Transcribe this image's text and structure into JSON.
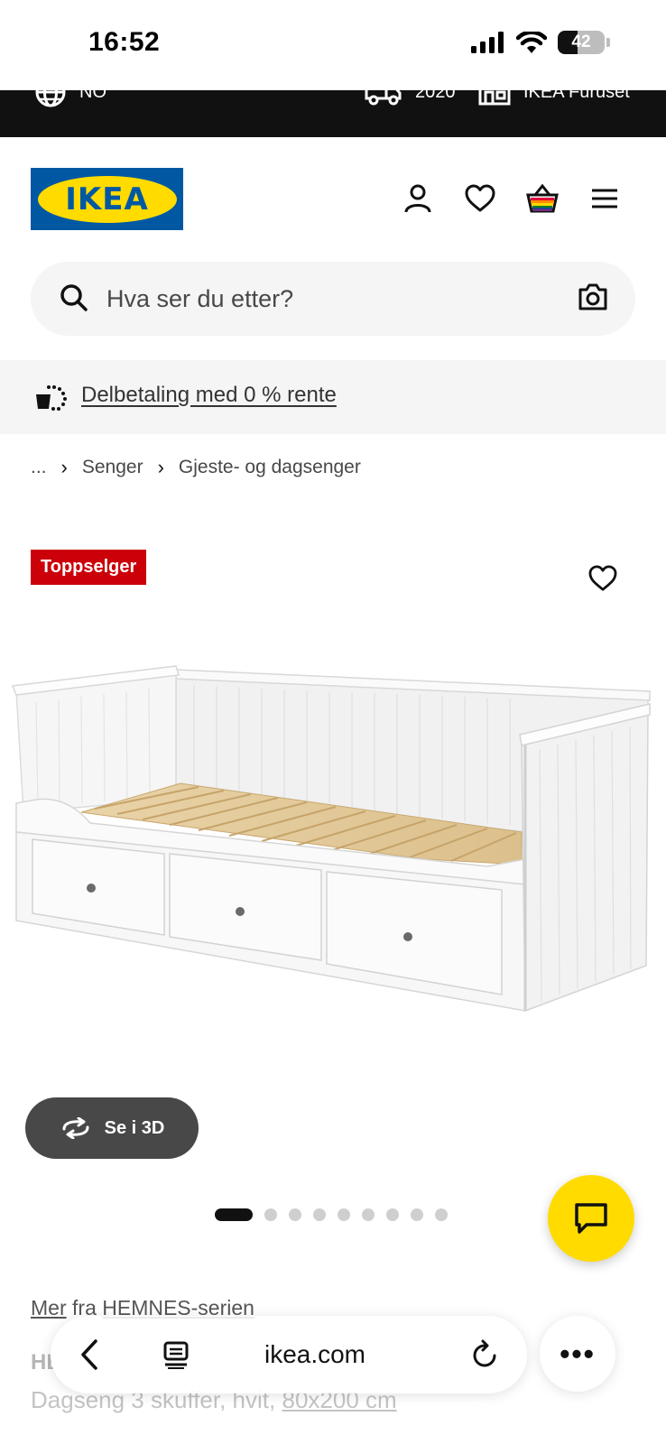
{
  "status_bar": {
    "time": "16:52",
    "battery": "42",
    "battery_level": 0.42
  },
  "top_strip": {
    "language": "NO",
    "delivery_postcode": "2020",
    "store": "IKEA Furuset"
  },
  "header": {
    "logo": "IKEA",
    "icons": [
      "user-icon",
      "heart-icon",
      "basket-icon",
      "menu-icon"
    ]
  },
  "search": {
    "placeholder": "Hva ser du etter?"
  },
  "promo": {
    "link_text": "Delbetaling med 0 % rente"
  },
  "breadcrumb": {
    "items": [
      "...",
      "Senger",
      "Gjeste- og dagsenger"
    ]
  },
  "product": {
    "badge": "Toppselger",
    "view_3d_label": "Se i 3D",
    "image_count": 9,
    "active_image": 1,
    "series_prefix": "Mer",
    "series_mid": "fra",
    "series_name": "HEMNES-serien",
    "name": "HEMNES",
    "desc_prefix": "Dagseng 3 skuffer, hvit,",
    "desc_size": "80x200 cm"
  },
  "browser": {
    "url": "ikea.com",
    "more_label": "•••"
  },
  "colors": {
    "brand_blue": "#0058a3",
    "brand_yellow": "#ffdb00",
    "badge_red": "#cc0008"
  }
}
